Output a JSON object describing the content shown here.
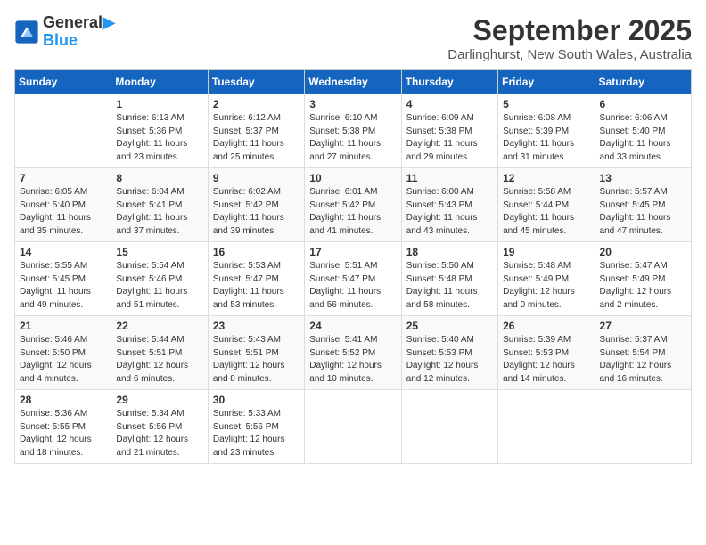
{
  "header": {
    "logo_line1": "General",
    "logo_line2": "Blue",
    "month": "September 2025",
    "location": "Darlinghurst, New South Wales, Australia"
  },
  "weekdays": [
    "Sunday",
    "Monday",
    "Tuesday",
    "Wednesday",
    "Thursday",
    "Friday",
    "Saturday"
  ],
  "weeks": [
    [
      {
        "day": "",
        "sunrise": "",
        "sunset": "",
        "daylight": ""
      },
      {
        "day": "1",
        "sunrise": "Sunrise: 6:13 AM",
        "sunset": "Sunset: 5:36 PM",
        "daylight": "Daylight: 11 hours and 23 minutes."
      },
      {
        "day": "2",
        "sunrise": "Sunrise: 6:12 AM",
        "sunset": "Sunset: 5:37 PM",
        "daylight": "Daylight: 11 hours and 25 minutes."
      },
      {
        "day": "3",
        "sunrise": "Sunrise: 6:10 AM",
        "sunset": "Sunset: 5:38 PM",
        "daylight": "Daylight: 11 hours and 27 minutes."
      },
      {
        "day": "4",
        "sunrise": "Sunrise: 6:09 AM",
        "sunset": "Sunset: 5:38 PM",
        "daylight": "Daylight: 11 hours and 29 minutes."
      },
      {
        "day": "5",
        "sunrise": "Sunrise: 6:08 AM",
        "sunset": "Sunset: 5:39 PM",
        "daylight": "Daylight: 11 hours and 31 minutes."
      },
      {
        "day": "6",
        "sunrise": "Sunrise: 6:06 AM",
        "sunset": "Sunset: 5:40 PM",
        "daylight": "Daylight: 11 hours and 33 minutes."
      }
    ],
    [
      {
        "day": "7",
        "sunrise": "Sunrise: 6:05 AM",
        "sunset": "Sunset: 5:40 PM",
        "daylight": "Daylight: 11 hours and 35 minutes."
      },
      {
        "day": "8",
        "sunrise": "Sunrise: 6:04 AM",
        "sunset": "Sunset: 5:41 PM",
        "daylight": "Daylight: 11 hours and 37 minutes."
      },
      {
        "day": "9",
        "sunrise": "Sunrise: 6:02 AM",
        "sunset": "Sunset: 5:42 PM",
        "daylight": "Daylight: 11 hours and 39 minutes."
      },
      {
        "day": "10",
        "sunrise": "Sunrise: 6:01 AM",
        "sunset": "Sunset: 5:42 PM",
        "daylight": "Daylight: 11 hours and 41 minutes."
      },
      {
        "day": "11",
        "sunrise": "Sunrise: 6:00 AM",
        "sunset": "Sunset: 5:43 PM",
        "daylight": "Daylight: 11 hours and 43 minutes."
      },
      {
        "day": "12",
        "sunrise": "Sunrise: 5:58 AM",
        "sunset": "Sunset: 5:44 PM",
        "daylight": "Daylight: 11 hours and 45 minutes."
      },
      {
        "day": "13",
        "sunrise": "Sunrise: 5:57 AM",
        "sunset": "Sunset: 5:45 PM",
        "daylight": "Daylight: 11 hours and 47 minutes."
      }
    ],
    [
      {
        "day": "14",
        "sunrise": "Sunrise: 5:55 AM",
        "sunset": "Sunset: 5:45 PM",
        "daylight": "Daylight: 11 hours and 49 minutes."
      },
      {
        "day": "15",
        "sunrise": "Sunrise: 5:54 AM",
        "sunset": "Sunset: 5:46 PM",
        "daylight": "Daylight: 11 hours and 51 minutes."
      },
      {
        "day": "16",
        "sunrise": "Sunrise: 5:53 AM",
        "sunset": "Sunset: 5:47 PM",
        "daylight": "Daylight: 11 hours and 53 minutes."
      },
      {
        "day": "17",
        "sunrise": "Sunrise: 5:51 AM",
        "sunset": "Sunset: 5:47 PM",
        "daylight": "Daylight: 11 hours and 56 minutes."
      },
      {
        "day": "18",
        "sunrise": "Sunrise: 5:50 AM",
        "sunset": "Sunset: 5:48 PM",
        "daylight": "Daylight: 11 hours and 58 minutes."
      },
      {
        "day": "19",
        "sunrise": "Sunrise: 5:48 AM",
        "sunset": "Sunset: 5:49 PM",
        "daylight": "Daylight: 12 hours and 0 minutes."
      },
      {
        "day": "20",
        "sunrise": "Sunrise: 5:47 AM",
        "sunset": "Sunset: 5:49 PM",
        "daylight": "Daylight: 12 hours and 2 minutes."
      }
    ],
    [
      {
        "day": "21",
        "sunrise": "Sunrise: 5:46 AM",
        "sunset": "Sunset: 5:50 PM",
        "daylight": "Daylight: 12 hours and 4 minutes."
      },
      {
        "day": "22",
        "sunrise": "Sunrise: 5:44 AM",
        "sunset": "Sunset: 5:51 PM",
        "daylight": "Daylight: 12 hours and 6 minutes."
      },
      {
        "day": "23",
        "sunrise": "Sunrise: 5:43 AM",
        "sunset": "Sunset: 5:51 PM",
        "daylight": "Daylight: 12 hours and 8 minutes."
      },
      {
        "day": "24",
        "sunrise": "Sunrise: 5:41 AM",
        "sunset": "Sunset: 5:52 PM",
        "daylight": "Daylight: 12 hours and 10 minutes."
      },
      {
        "day": "25",
        "sunrise": "Sunrise: 5:40 AM",
        "sunset": "Sunset: 5:53 PM",
        "daylight": "Daylight: 12 hours and 12 minutes."
      },
      {
        "day": "26",
        "sunrise": "Sunrise: 5:39 AM",
        "sunset": "Sunset: 5:53 PM",
        "daylight": "Daylight: 12 hours and 14 minutes."
      },
      {
        "day": "27",
        "sunrise": "Sunrise: 5:37 AM",
        "sunset": "Sunset: 5:54 PM",
        "daylight": "Daylight: 12 hours and 16 minutes."
      }
    ],
    [
      {
        "day": "28",
        "sunrise": "Sunrise: 5:36 AM",
        "sunset": "Sunset: 5:55 PM",
        "daylight": "Daylight: 12 hours and 18 minutes."
      },
      {
        "day": "29",
        "sunrise": "Sunrise: 5:34 AM",
        "sunset": "Sunset: 5:56 PM",
        "daylight": "Daylight: 12 hours and 21 minutes."
      },
      {
        "day": "30",
        "sunrise": "Sunrise: 5:33 AM",
        "sunset": "Sunset: 5:56 PM",
        "daylight": "Daylight: 12 hours and 23 minutes."
      },
      {
        "day": "",
        "sunrise": "",
        "sunset": "",
        "daylight": ""
      },
      {
        "day": "",
        "sunrise": "",
        "sunset": "",
        "daylight": ""
      },
      {
        "day": "",
        "sunrise": "",
        "sunset": "",
        "daylight": ""
      },
      {
        "day": "",
        "sunrise": "",
        "sunset": "",
        "daylight": ""
      }
    ]
  ]
}
